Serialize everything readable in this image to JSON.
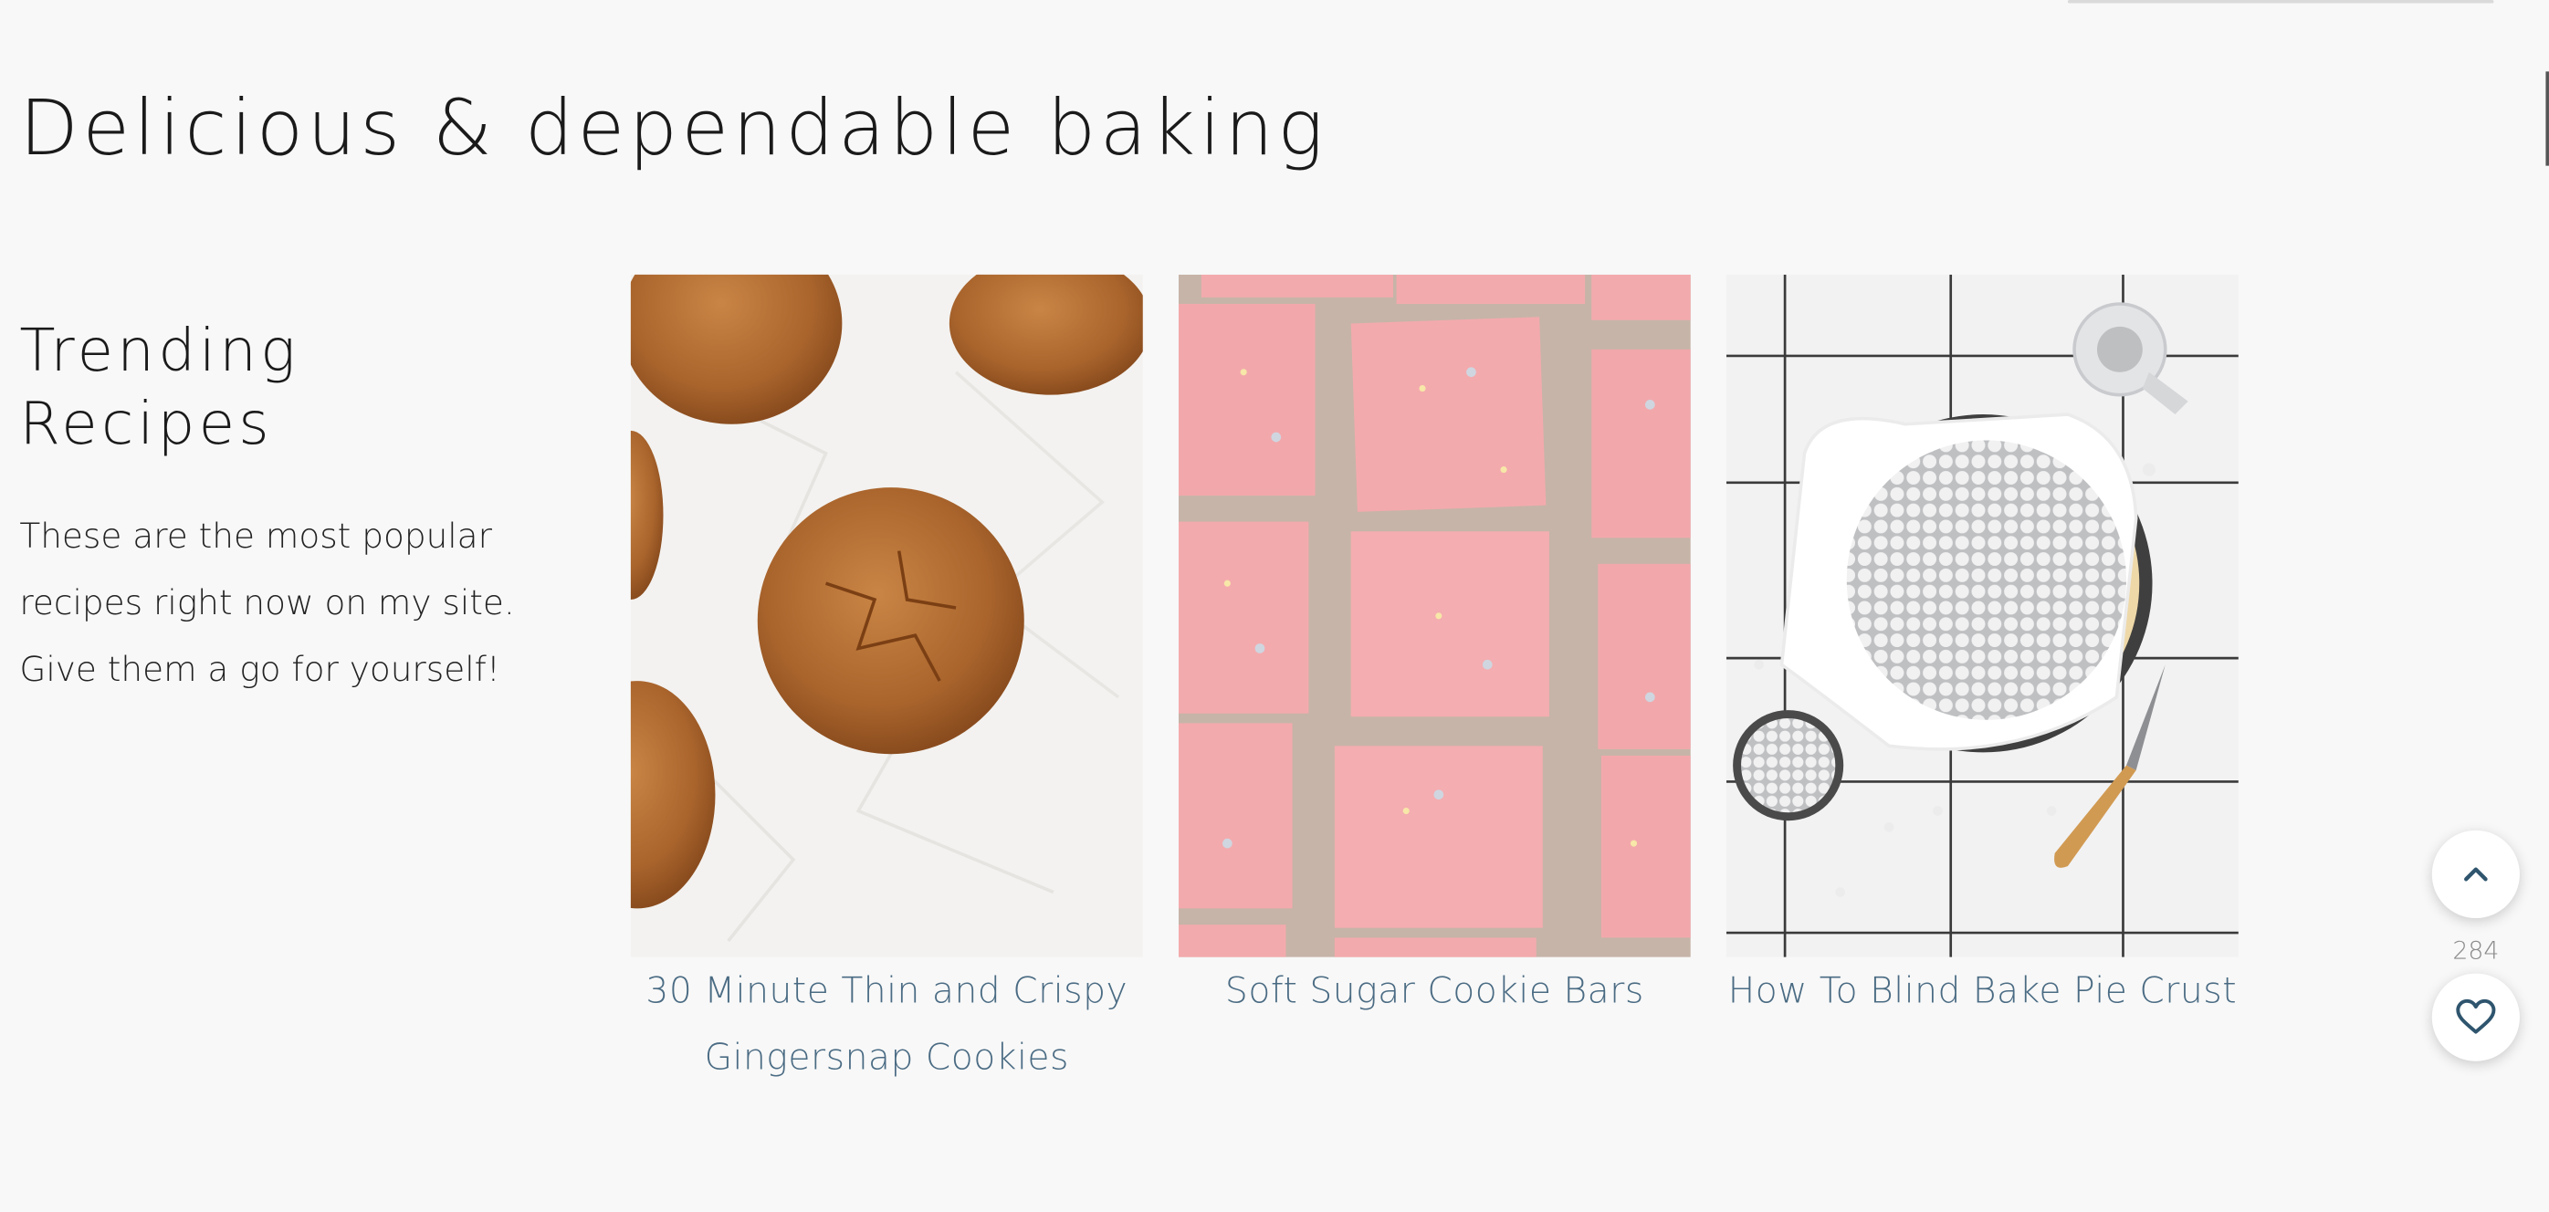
{
  "page": {
    "title": "Delicious & dependable baking"
  },
  "trending": {
    "heading": "Trending Recipes",
    "description": "These are the most popular recipes right now on my site. Give them a go for yourself!",
    "recipes": [
      {
        "title": "30 Minute Thin and Crispy Gingersnap Cookies",
        "image": "gingersnap-cookies-photo"
      },
      {
        "title": "Soft Sugar Cookie Bars",
        "image": "sugar-cookie-bars-photo"
      },
      {
        "title": "How To Blind Bake Pie Crust",
        "image": "blind-bake-pie-crust-photo"
      }
    ]
  },
  "floating": {
    "like_count": "284",
    "scroll_top_icon": "chevron-up-icon",
    "like_icon": "heart-icon"
  },
  "colors": {
    "background": "#f8f8f8",
    "link": "#4a6b83",
    "frosting": "#f3aaad",
    "cookie": "#b06d34"
  }
}
